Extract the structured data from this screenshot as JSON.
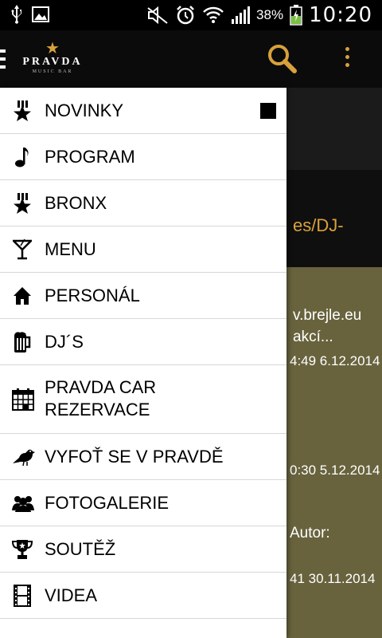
{
  "status_bar": {
    "battery_percent": "38%",
    "time": "10:20",
    "icons": [
      "usb-icon",
      "image-icon",
      "mute-icon",
      "alarm-icon",
      "wifi-icon",
      "signal-icon",
      "battery-charging-icon"
    ]
  },
  "action_bar": {
    "logo_name": "PRAVDA",
    "logo_sub": "MUSIC BAR",
    "accent_color": "#d8a23b"
  },
  "background": {
    "line1": "es/DJ-",
    "line2": "v.brejle.eu",
    "line3": "akcí...",
    "line4": "4:49 6.12.2014",
    "line5": "0:30 5.12.2014",
    "line6": "Autor:",
    "line7": "41 30.11.2014"
  },
  "drawer": {
    "items": [
      {
        "label": "NOVINKY",
        "icon": "star-bars-icon"
      },
      {
        "label": "PROGRAM",
        "icon": "music-note-icon"
      },
      {
        "label": "BRONX",
        "icon": "star-bars-icon"
      },
      {
        "label": "MENU",
        "icon": "cocktail-icon"
      },
      {
        "label": "PERSONÁL",
        "icon": "home-icon"
      },
      {
        "label": "DJ´S",
        "icon": "beer-mug-icon"
      },
      {
        "label": "PRAVDA CAR\nREZERVACE",
        "icon": "calendar-icon"
      },
      {
        "label": "VYFOŤ SE V PRAVDĚ",
        "icon": "bird-icon"
      },
      {
        "label": "FOTOGALERIE",
        "icon": "people-icon"
      },
      {
        "label": "SOUTĚŽ",
        "icon": "trophy-icon"
      },
      {
        "label": "VIDEA",
        "icon": "film-icon"
      }
    ]
  }
}
